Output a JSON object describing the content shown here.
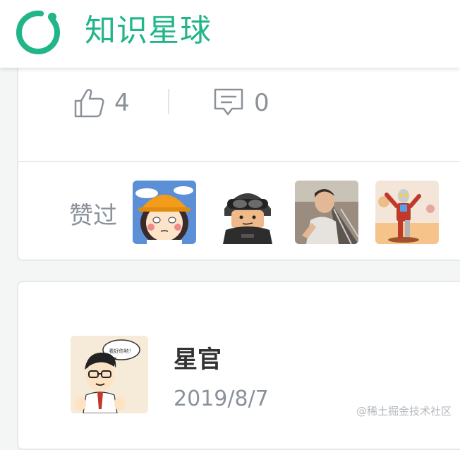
{
  "header": {
    "brand": "知识星球",
    "logo_icon": "ring-logo-icon",
    "brand_color": "#21b589"
  },
  "post_actions": {
    "like_icon": "thumbs-up-icon",
    "like_count": "4",
    "comment_icon": "comment-icon",
    "comment_count": "0"
  },
  "liked_by": {
    "label": "赞过",
    "avatars": [
      {
        "name": "cartoon-girl-avatar"
      },
      {
        "name": "swat-soldier-avatar"
      },
      {
        "name": "man-photo-avatar"
      },
      {
        "name": "ultraman-figure-avatar"
      }
    ]
  },
  "next_post": {
    "author": "星官",
    "date": "2019/8/7",
    "avatar_bubble_text": "看好你哟！"
  },
  "watermark": "@稀土掘金技术社区"
}
